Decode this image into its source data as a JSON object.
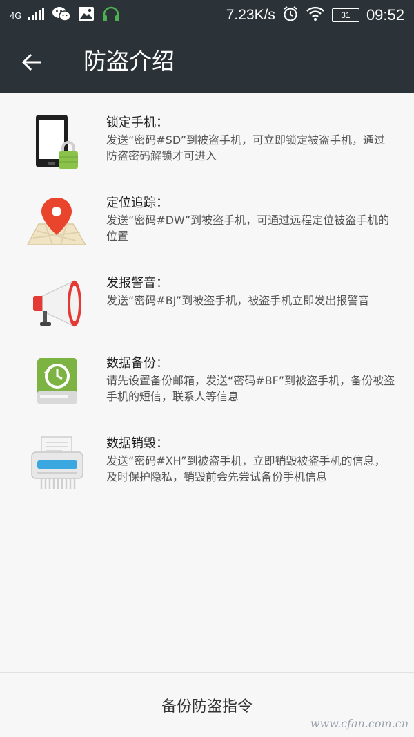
{
  "status_bar": {
    "network": "4G",
    "speed": "7.23K/s",
    "battery": "31",
    "time": "09:52",
    "icons": [
      "signal-icon",
      "wechat-icon",
      "image-icon",
      "headphones-icon",
      "alarm-icon",
      "wifi-icon",
      "battery-icon"
    ]
  },
  "app_bar": {
    "title": "防盗介绍"
  },
  "items": [
    {
      "title": "锁定手机：",
      "desc": "发送“密码#SD”到被盗手机，可立即锁定被盗手机，通过防盗密码解锁才可进入",
      "icon": "phone-lock-icon"
    },
    {
      "title": "定位追踪：",
      "desc": "发送“密码#DW”到被盗手机，可通过远程定位被盗手机的位置",
      "icon": "map-pin-icon"
    },
    {
      "title": "发报警音：",
      "desc": "发送“密码#BJ”到被盗手机，被盗手机立即发出报警音",
      "icon": "megaphone-icon"
    },
    {
      "title": "数据备份：",
      "desc": "请先设置备份邮箱，发送“密码#BF”到被盗手机，备份被盗手机的短信，联系人等信息",
      "icon": "backup-drive-icon"
    },
    {
      "title": "数据销毁：",
      "desc": "发送“密码#XH”到被盗手机，立即销毁被盗手机的信息，及时保护隐私，销毁前会先尝试备份手机信息",
      "icon": "shredder-icon"
    }
  ],
  "bottom_button": {
    "label": "备份防盗指令"
  },
  "watermark": "www.cfan.com.cn"
}
